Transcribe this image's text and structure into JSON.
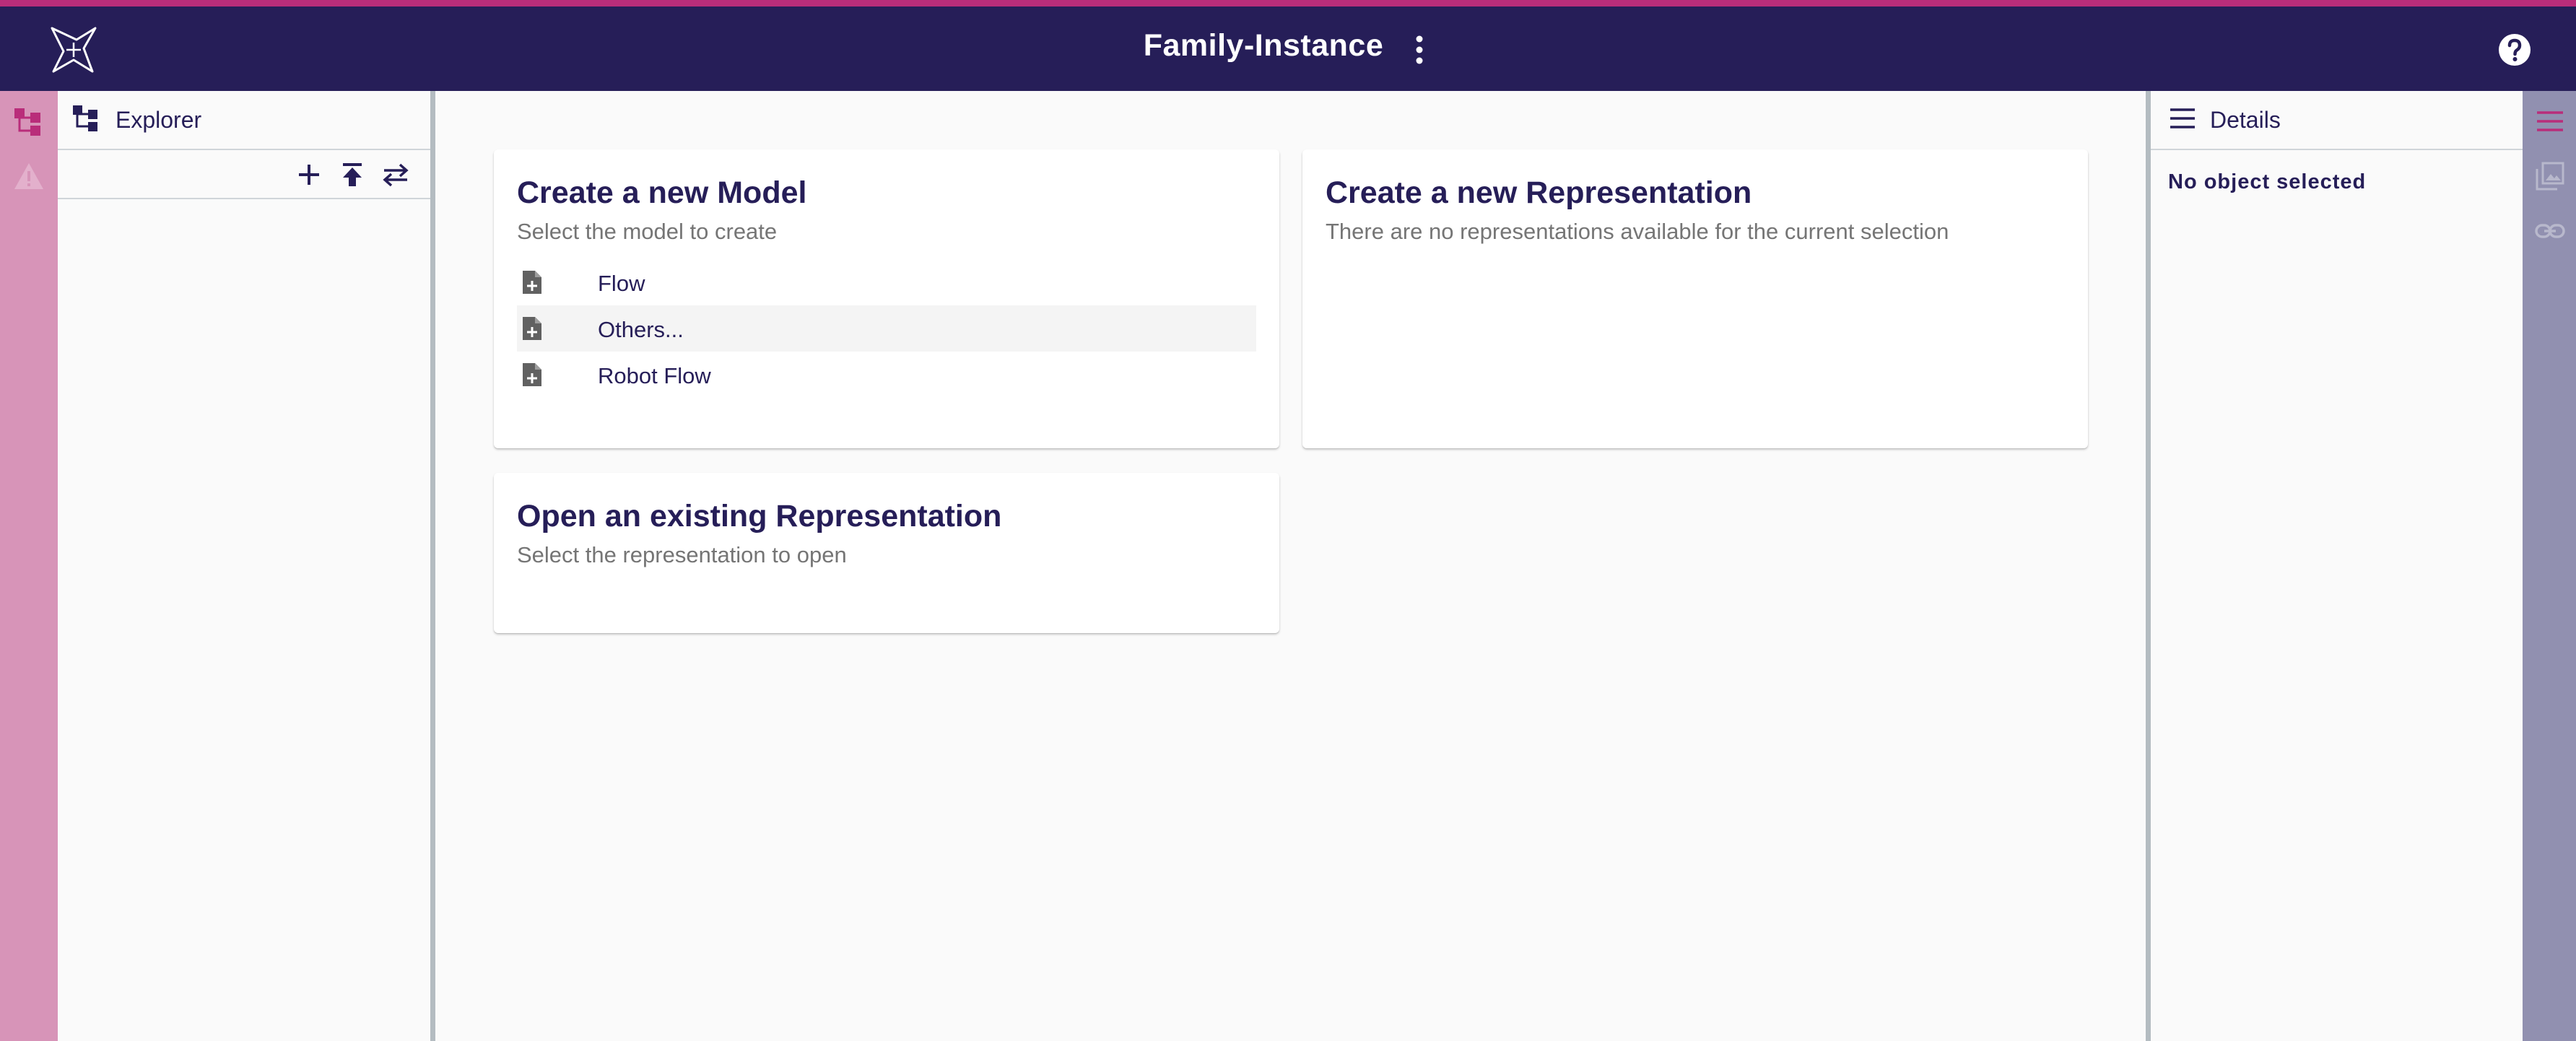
{
  "app": {
    "title": "Family-Instance"
  },
  "colors": {
    "header_bg": "#261e58",
    "accent": "#b92d7a",
    "left_bar": "#d794b8",
    "right_bar": "#9190b0",
    "text_primary": "#261e58",
    "text_secondary": "#757575"
  },
  "header": {
    "logo_icon": "sirius-star-logo",
    "menu_icon": "more-vertical-icon",
    "help_icon": "help-circle-icon"
  },
  "left_bar": {
    "icons": [
      "explorer-tree-icon",
      "warning-icon"
    ]
  },
  "explorer": {
    "title": "Explorer",
    "toolbar_icons": [
      "add-icon",
      "upload-icon",
      "swap-icon"
    ]
  },
  "main": {
    "create_model": {
      "title": "Create a new Model",
      "subtitle": "Select the model to create",
      "items": [
        {
          "label": "Flow"
        },
        {
          "label": "Others..."
        },
        {
          "label": "Robot Flow"
        }
      ]
    },
    "create_representation": {
      "title": "Create a new Representation",
      "subtitle": "There are no representations available for the current selection"
    },
    "open_representation": {
      "title": "Open an existing Representation",
      "subtitle": "Select the representation to open"
    }
  },
  "details": {
    "title": "Details",
    "empty_text": "No object selected"
  },
  "right_bar": {
    "icons": [
      "details-menu-icon",
      "image-library-icon",
      "link-icon"
    ]
  }
}
